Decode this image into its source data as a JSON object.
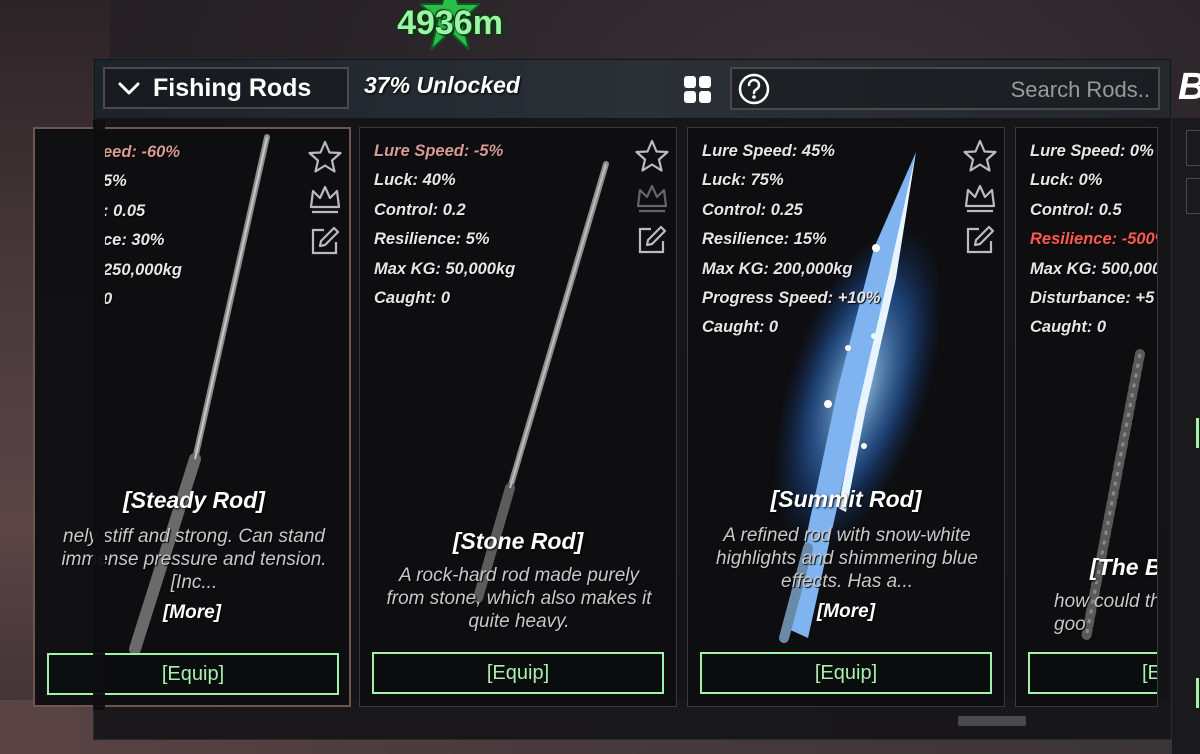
{
  "depth": "4936m",
  "header": {
    "category_label": "Fishing Rods",
    "unlocked_text": "37% Unlocked",
    "search_placeholder": "Search Rods..",
    "right_cutoff": "B"
  },
  "cards": [
    {
      "stats": [
        "eed: -60%",
        "5%",
        ": 0.05",
        "ce: 30%",
        "250,000kg",
        "0"
      ],
      "name": "[Steady Rod]",
      "desc": "nely stiff and strong. Can stand immense pressure and tension. [Inc...",
      "more": "[More]",
      "equip": "[Equip]"
    },
    {
      "stats": [
        "Lure Speed: -5%",
        "Luck: 40%",
        "Control: 0.2",
        "Resilience: 5%",
        "Max KG: 50,000kg",
        "Caught: 0"
      ],
      "name": "[Stone Rod]",
      "desc": "A rock-hard rod made purely from stone, which also makes it quite heavy.",
      "equip": "[Equip]"
    },
    {
      "stats": [
        "Lure Speed: 45%",
        "Luck: 75%",
        "Control: 0.25",
        "Resilience: 15%",
        "Max KG: 200,000kg",
        "Progress Speed: +10%",
        "Caught: 0"
      ],
      "name": "[Summit Rod]",
      "desc": "A refined rod with snow-white highlights and shimmering blue effects. Has a...",
      "more": "[More]",
      "equip": "[Equip]"
    },
    {
      "stats": [
        "Lure Speed: 0%",
        "Luck: 0%",
        "Control: 0.5",
        "Resilience: -500%",
        "Max KG: 500,000,",
        "Disturbance: +5",
        "Caught: 0"
      ],
      "name": "[The B",
      "desc": "how could th goo",
      "equip": "[E"
    }
  ],
  "colors": {
    "equip_border": "#9ff2a8",
    "negative_stat": "#d89a95",
    "severe_negative_stat": "#ff5a52",
    "depth_text": "#9cf5a4"
  }
}
